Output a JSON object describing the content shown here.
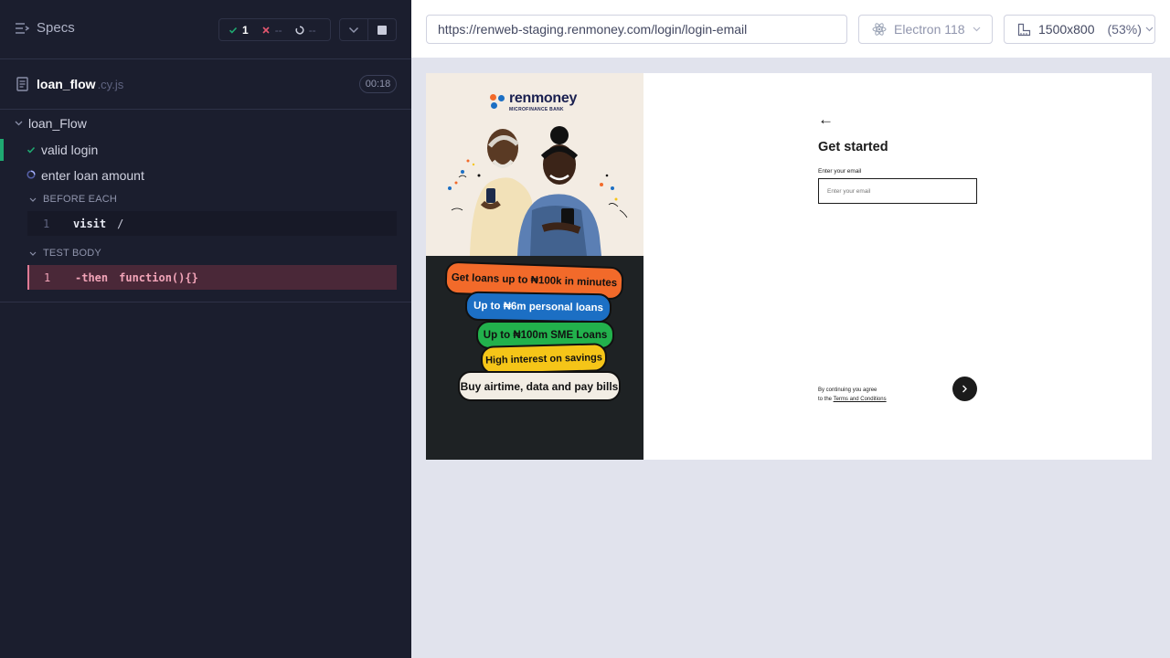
{
  "reporter": {
    "specs_label": "Specs",
    "stats": {
      "passed": "1",
      "failed": "--",
      "pending": "--"
    },
    "spec": {
      "name": "loan_flow",
      "ext": ".cy.js",
      "duration": "00:18"
    },
    "suite_title": "loan_Flow",
    "tests": [
      {
        "title": "valid login",
        "state": "passed"
      },
      {
        "title": "enter loan amount",
        "state": "running"
      }
    ],
    "hooks": {
      "before_each": {
        "label": "BEFORE EACH",
        "commands": [
          {
            "num": "1",
            "name": "visit",
            "arg": "/"
          }
        ]
      },
      "test_body": {
        "label": "TEST BODY",
        "commands": [
          {
            "num": "1",
            "name": "-then",
            "arg": "function(){}"
          }
        ]
      }
    }
  },
  "aut_header": {
    "url": "https://renweb-staging.renmoney.com/login/login-email",
    "browser": "Electron 118",
    "viewport": "1500x800",
    "scale": "(53%)"
  },
  "app": {
    "brand": {
      "name": "renmoney",
      "subtitle": "MICROFINANCE BANK"
    },
    "promos": [
      "Get loans up to ₦100k in minutes",
      "Up to ₦6m personal loans",
      "Up to ₦100m SME Loans",
      "High interest on savings",
      "Buy airtime, data and pay bills"
    ],
    "login": {
      "title": "Get started",
      "email_label": "Enter your email",
      "email_placeholder": "Enter your email",
      "terms_prefix_1": "By continuing you agree",
      "terms_prefix_2": "to the ",
      "terms_link": "Terms and Conditions"
    }
  },
  "colors": {
    "reporter_bg": "#1b1e2e",
    "pass_green": "#1fa971",
    "fail_red": "#e45770",
    "running_blue": "#7b8cf5",
    "promo_orange": "#f26a2a",
    "promo_blue": "#1c6fc4",
    "promo_green": "#22b14c",
    "promo_yellow": "#f5c518"
  }
}
